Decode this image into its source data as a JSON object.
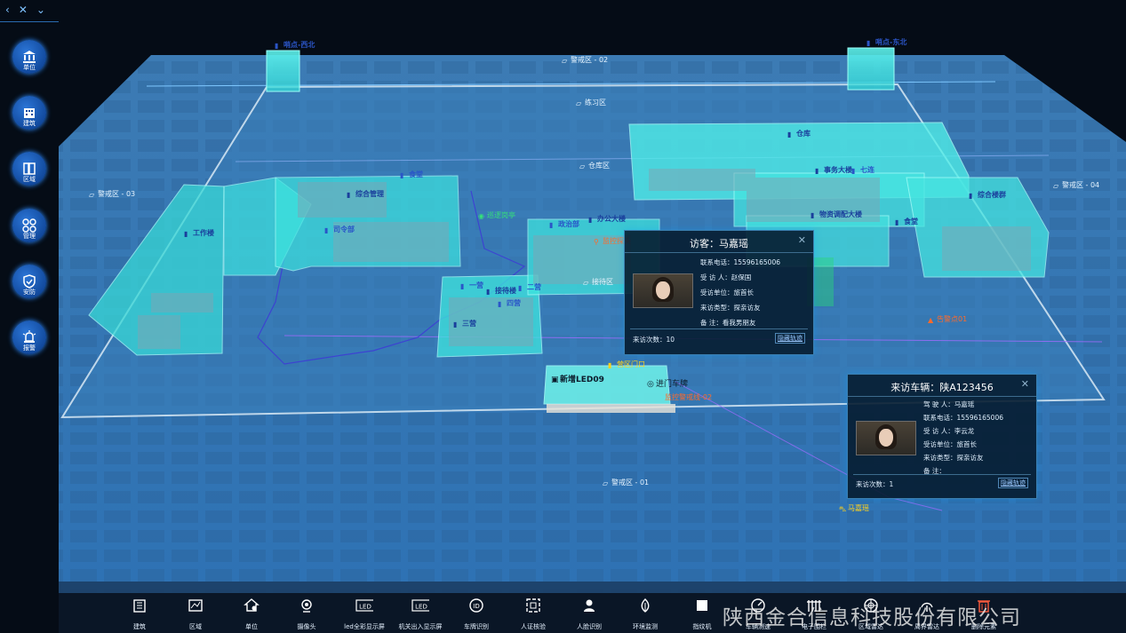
{
  "top_nav": {
    "back": "‹",
    "collapse": "✕",
    "expand": "⌄"
  },
  "sidebar": {
    "items": [
      {
        "label": "单位",
        "icon": "institution-icon"
      },
      {
        "label": "建筑",
        "icon": "building-icon"
      },
      {
        "label": "区域",
        "icon": "region-icon"
      },
      {
        "label": "管理",
        "icon": "grid-icon"
      },
      {
        "label": "安防",
        "icon": "shield-icon"
      },
      {
        "label": "报警",
        "icon": "alarm-icon"
      }
    ]
  },
  "map": {
    "labels": {
      "sentry_nw": "哨点-西北",
      "sentry_ne": "哨点-东北",
      "zone02": "警戒区 - 02",
      "training": "练习区",
      "warehouse_zone": "仓库区",
      "zone03": "警戒区 - 03",
      "zone04": "警戒区 - 04",
      "zone01": "警戒区 - 01",
      "warehouse": "仓库",
      "affairs": "事务大楼",
      "seven": "七连",
      "canteen": "食堂",
      "comprehensive": "综合楼群",
      "dispatch": "物资调配大楼",
      "cafeteria": "食堂",
      "comp_mgmt": "综合管理",
      "hq": "司令部",
      "workshop": "工作楼",
      "admin": "办公大楼",
      "politics": "政治部",
      "camp": "一营",
      "reception": "接待楼",
      "two": "二营",
      "four": "四营",
      "three": "三营",
      "reception_area": "接待区",
      "patrol": "巡逻岗亭",
      "gate_area": "营区门口",
      "camera_a": "监控探头",
      "led": "新增LED09",
      "plate": "进门车牌",
      "cam_b": "摄像头03",
      "patrol_zone": "巡逻岗哨",
      "visitor_car": "马嘉瑶",
      "alert_pt": "告警点01",
      "gate_light": "监控警戒线-02"
    }
  },
  "visitor_popup": {
    "title": "访客：马嘉瑶",
    "phone_label": "联系电话：",
    "phone": "15596165006",
    "host_label": "受 访 人：",
    "host": "赵保国",
    "unit_label": "受访单位：",
    "unit": "旅首长",
    "type_label": "来访类型：",
    "type": "探亲访友",
    "note_label": "备 注：",
    "note": "看我男朋友",
    "visits_label": "来访次数：",
    "visits": "10",
    "hide_track": "隐藏轨迹"
  },
  "vehicle_popup": {
    "title": "来访车辆：陕A123456",
    "driver_label": "驾 驶 人：",
    "driver": "马嘉瑶",
    "phone_label": "联系电话：",
    "phone": "15596165006",
    "host_label": "受 访 人：",
    "host": "李云龙",
    "unit_label": "受访单位：",
    "unit": "旅首长",
    "type_label": "来访类型：",
    "type": "探亲访友",
    "note_label": "备 注：",
    "note": "",
    "visits_label": "来访次数：",
    "visits": "1",
    "hide_track": "隐藏轨迹"
  },
  "toolbar": {
    "items": [
      {
        "label": "建筑",
        "icon": "building-icon"
      },
      {
        "label": "区域",
        "icon": "map-icon"
      },
      {
        "label": "单位",
        "icon": "house-gear-icon"
      },
      {
        "label": "摄像头",
        "icon": "camera-icon"
      },
      {
        "label": "led全彩显示屏",
        "icon": "led-icon"
      },
      {
        "label": "机关出入显示屏",
        "icon": "led-icon"
      },
      {
        "label": "车牌识别",
        "icon": "plate-icon"
      },
      {
        "label": "人证核验",
        "icon": "id-check-icon"
      },
      {
        "label": "人脸识别",
        "icon": "face-icon"
      },
      {
        "label": "环境监测",
        "icon": "leaf-icon"
      },
      {
        "label": "指纹机",
        "icon": "fingerprint-icon"
      },
      {
        "label": "车辆测速",
        "icon": "speed-icon"
      },
      {
        "label": "电子围栏",
        "icon": "fence-icon"
      },
      {
        "label": "区域雷达",
        "icon": "radar-icon"
      },
      {
        "label": "周界雷达",
        "icon": "radar-icon"
      },
      {
        "label": "删除元素",
        "icon": "trash-icon"
      }
    ]
  },
  "watermark": "陕西金合信息科技股份有限公司"
}
